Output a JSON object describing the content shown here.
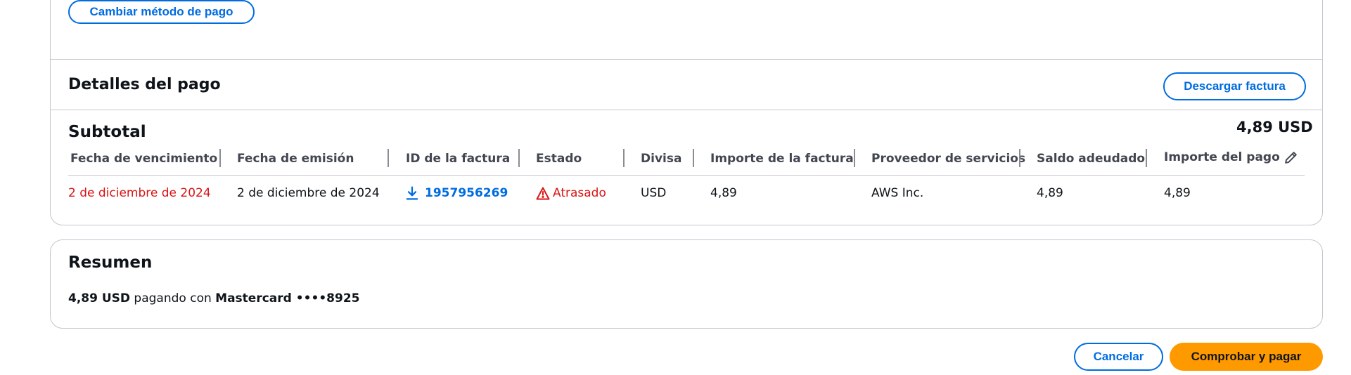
{
  "top": {
    "change_payment_label": "Cambiar método de pago"
  },
  "details": {
    "title": "Detalles del pago",
    "download_label": "Descargar factura",
    "subtotal_label": "Subtotal",
    "subtotal_value": "4,89 USD",
    "columns": [
      "Fecha de vencimiento",
      "Fecha de emisión",
      "ID de la factura",
      "Estado",
      "Divisa",
      "Importe de la factura",
      "Proveedor de servicios",
      "Saldo adeudado",
      "Importe del pago"
    ],
    "row": {
      "due_date": "2 de diciembre de 2024",
      "issue_date": "2 de diciembre de 2024",
      "invoice_id": "1957956269",
      "status": "Atrasado",
      "currency": "USD",
      "invoice_amount": "4,89",
      "provider": "AWS Inc.",
      "balance_due": "4,89",
      "payment_amount": "4,89"
    }
  },
  "summary": {
    "title": "Resumen",
    "amount": "4,89 USD",
    "paying_with": " pagando con ",
    "card": "Mastercard ••••8925"
  },
  "footer": {
    "cancel_label": "Cancelar",
    "confirm_label": "Comprobar y pagar"
  },
  "colors": {
    "accent": "#006ce0",
    "primary_button": "#ff9900",
    "overdue": "#d91515",
    "border": "#c6c6cd"
  },
  "icons": {
    "download": "download-icon",
    "warning": "warning-icon",
    "edit": "pencil-icon"
  }
}
